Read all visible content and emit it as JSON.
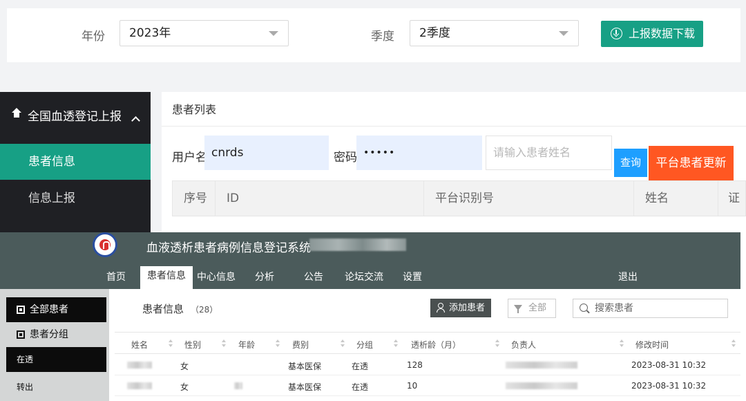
{
  "filter_panel": {
    "year_label": "年份",
    "year_value": "2023年",
    "quarter_label": "季度",
    "quarter_value": "2季度",
    "download_label": "上报数据下载",
    "accent_color": "#17a085"
  },
  "registry_panel": {
    "sidebar": {
      "header": "全国血透登记上报",
      "items": [
        {
          "label": "患者信息",
          "active": true
        },
        {
          "label": "信息上报",
          "active": false
        }
      ]
    },
    "list_title": "患者列表",
    "username_label": "用户名",
    "username_value": "cnrds",
    "password_label": "密码",
    "password_value": "•••••",
    "name_placeholder": "请输入患者姓名",
    "query_label": "查询",
    "update_label": "平台患者更新",
    "columns": [
      "序号",
      "ID",
      "平台识别号",
      "姓名",
      "证"
    ]
  },
  "hd_system": {
    "system_title": "血液透析患者病例信息登记系统 ·",
    "nav": [
      "首页",
      "患者信息",
      "中心信息",
      "分析",
      "公告",
      "论坛交流",
      "设置"
    ],
    "logout": "退出",
    "left_menu": [
      {
        "label": "全部患者",
        "style": "dark",
        "icon": "square-icon"
      },
      {
        "label": "患者分组",
        "style": "plain",
        "icon": "square-icon"
      },
      {
        "label": "在透",
        "style": "dark"
      },
      {
        "label": "转出",
        "style": "plain"
      }
    ],
    "patients_title": "患者信息",
    "patients_count": "（28）",
    "add_patient": "添加患者",
    "filter_all": "全部",
    "search_placeholder": "搜索患者",
    "columns": [
      "姓名",
      "性别",
      "年龄",
      "费别",
      "分组",
      "透析龄（月）",
      "负责人",
      "修改时间"
    ],
    "rows": [
      {
        "name": "[已打码]",
        "gender": "女",
        "age": "",
        "fee": "基本医保",
        "group": "在透",
        "dialysis_months": "128",
        "manager": "[已打码]",
        "modified": "2023-08-31 10:32"
      },
      {
        "name": "[已打码]",
        "gender": "女",
        "age": "[已打码]",
        "fee": "基本医保",
        "group": "在透",
        "dialysis_months": "10",
        "manager": "[已打码]",
        "modified": "2023-08-31 10:32"
      }
    ]
  }
}
